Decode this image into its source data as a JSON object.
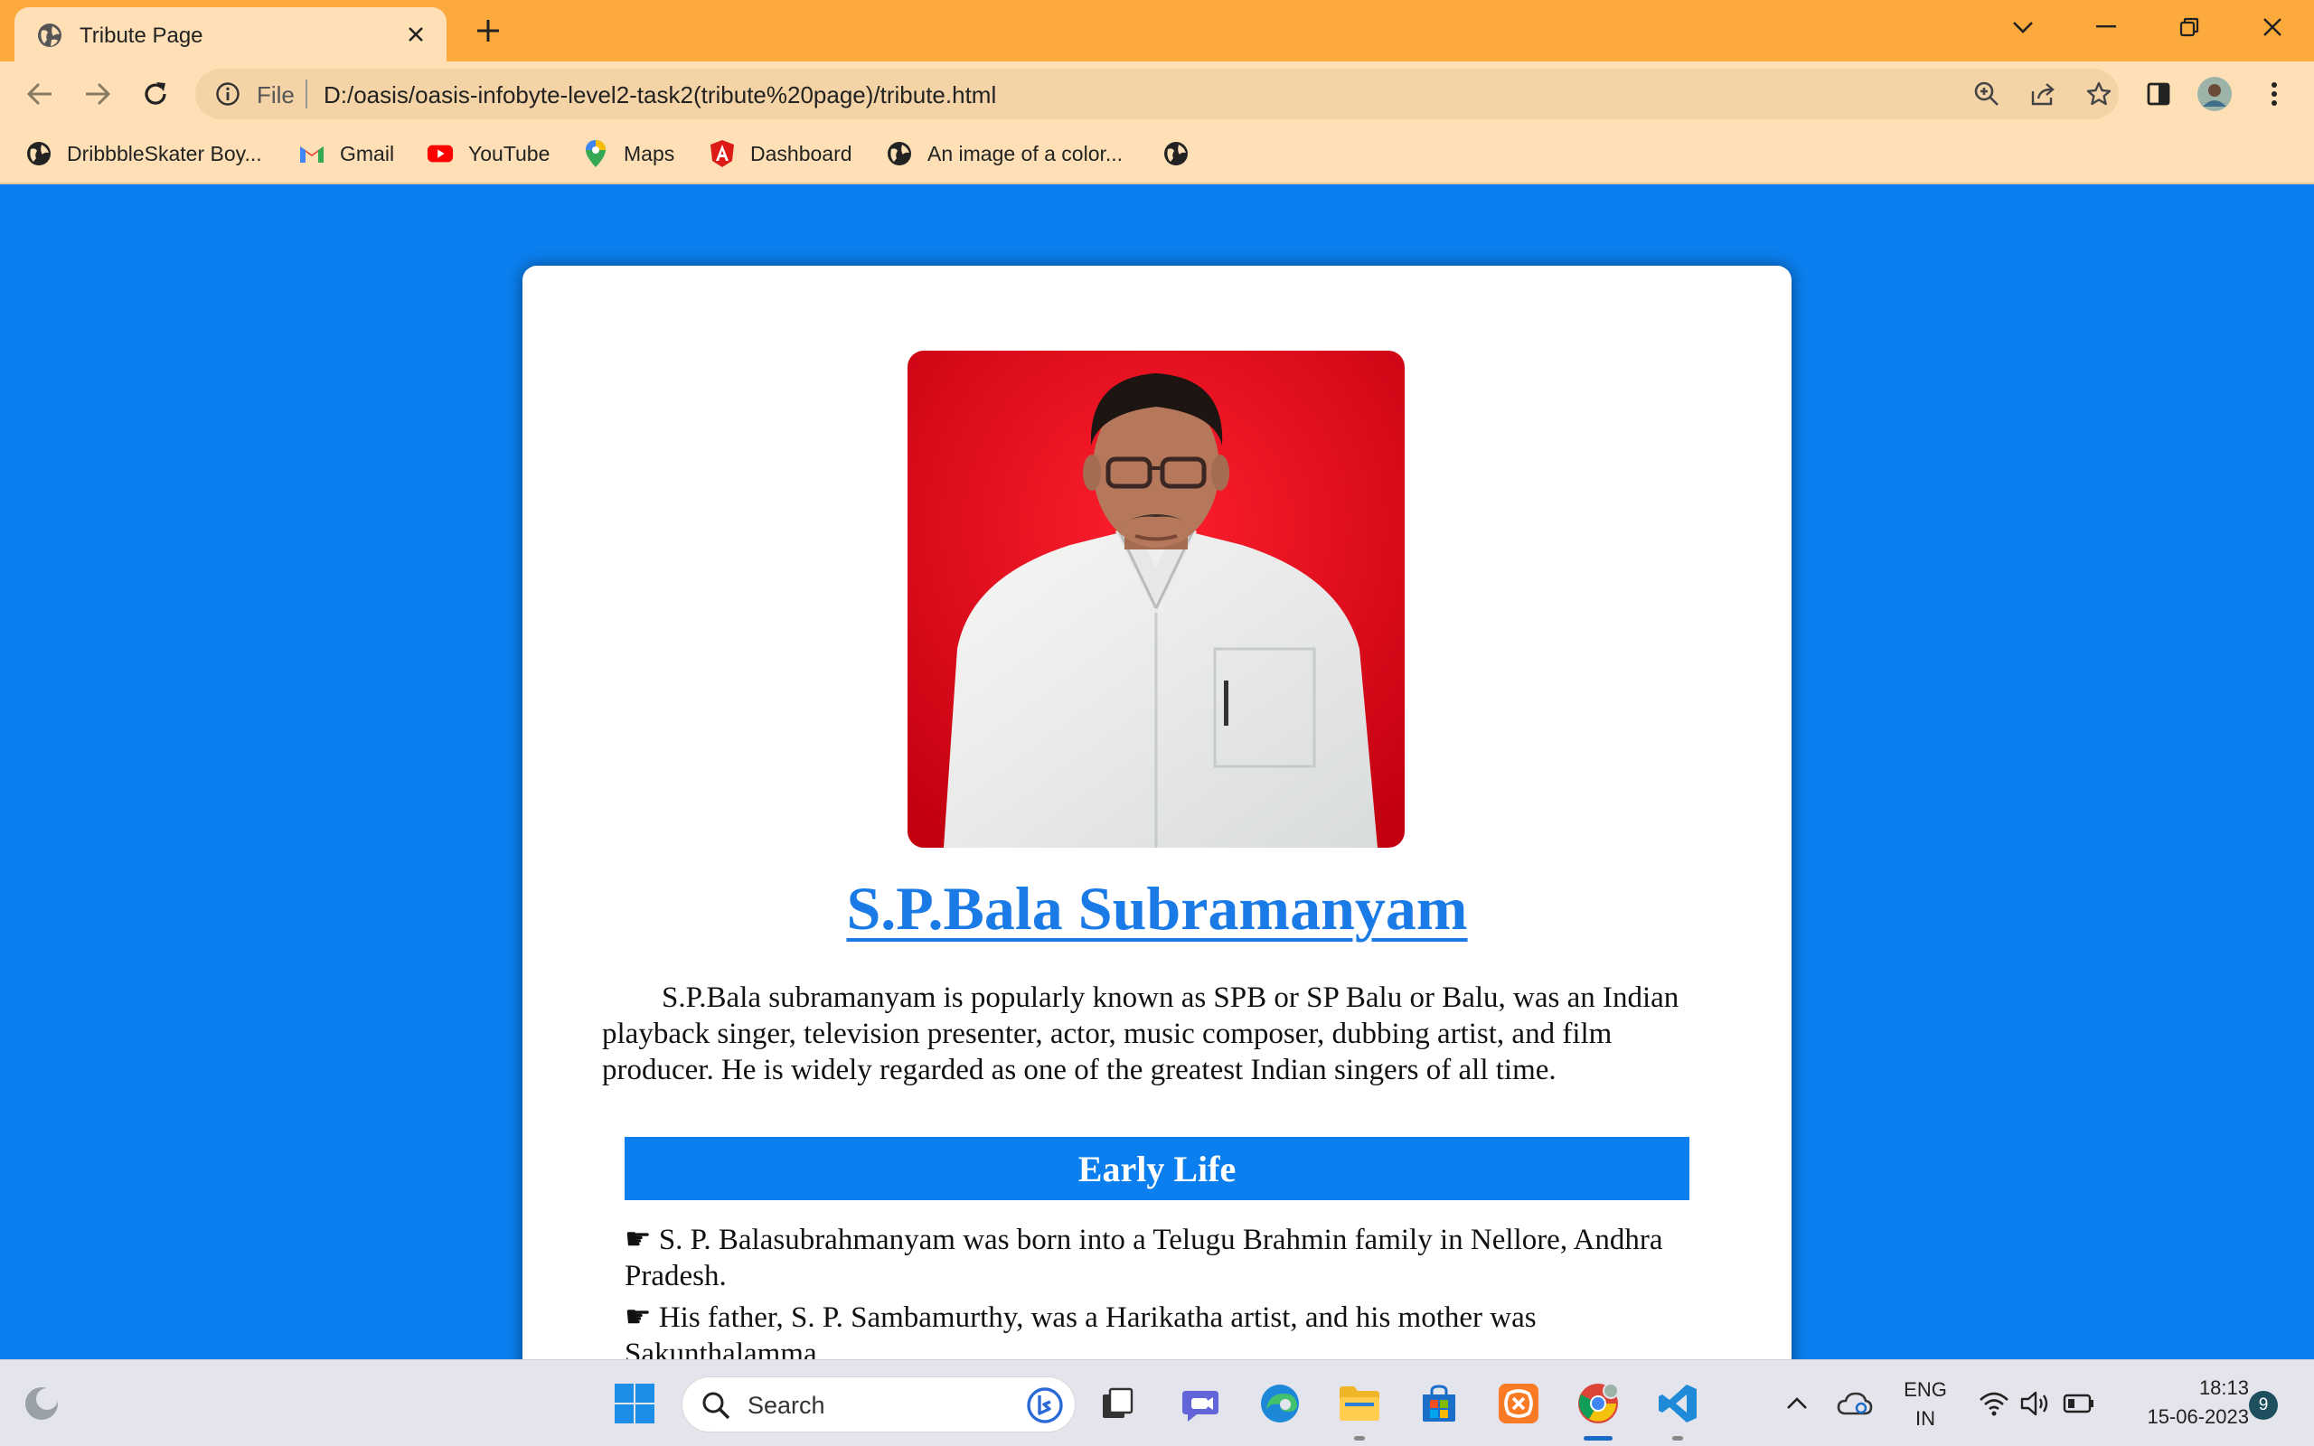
{
  "browser": {
    "tab_title": "Tribute Page",
    "omnibox_scheme": "File",
    "url": "D:/oasis/oasis-infobyte-level2-task2(tribute%20page)/tribute.html",
    "theme_color": "#fdaa3c"
  },
  "bookmarks": [
    {
      "label": "DribbbleSkater Boy...",
      "icon": "globe-icon"
    },
    {
      "label": "Gmail",
      "icon": "gmail-icon"
    },
    {
      "label": "YouTube",
      "icon": "youtube-icon"
    },
    {
      "label": "Maps",
      "icon": "maps-icon"
    },
    {
      "label": "Dashboard",
      "icon": "angular-icon"
    },
    {
      "label": "An image of a color...",
      "icon": "globe-icon"
    },
    {
      "label": "",
      "icon": "globe-icon"
    }
  ],
  "page": {
    "background_color": "#0b7fef",
    "heading": "S.P.Bala Subramanyam",
    "intro": "S.P.Bala subramanyam is popularly known as SPB or SP Balu or Balu, was an Indian playback singer, television presenter, actor, music composer, dubbing artist, and film producer. He is widely regarded as one of the greatest Indian singers of all time.",
    "section_title": "Early Life",
    "facts": [
      "☛ S. P. Balasubrahmanyam was born into a Telugu Brahmin family in Nellore, Andhra Pradesh.",
      "☛ His father, S. P. Sambamurthy, was a Harikatha artist, and his mother was Sakunthalamma."
    ]
  },
  "taskbar": {
    "search_placeholder": "Search",
    "language": "ENG",
    "region": "IN",
    "time": "18:13",
    "date": "15-06-2023",
    "notification_count": "9"
  }
}
